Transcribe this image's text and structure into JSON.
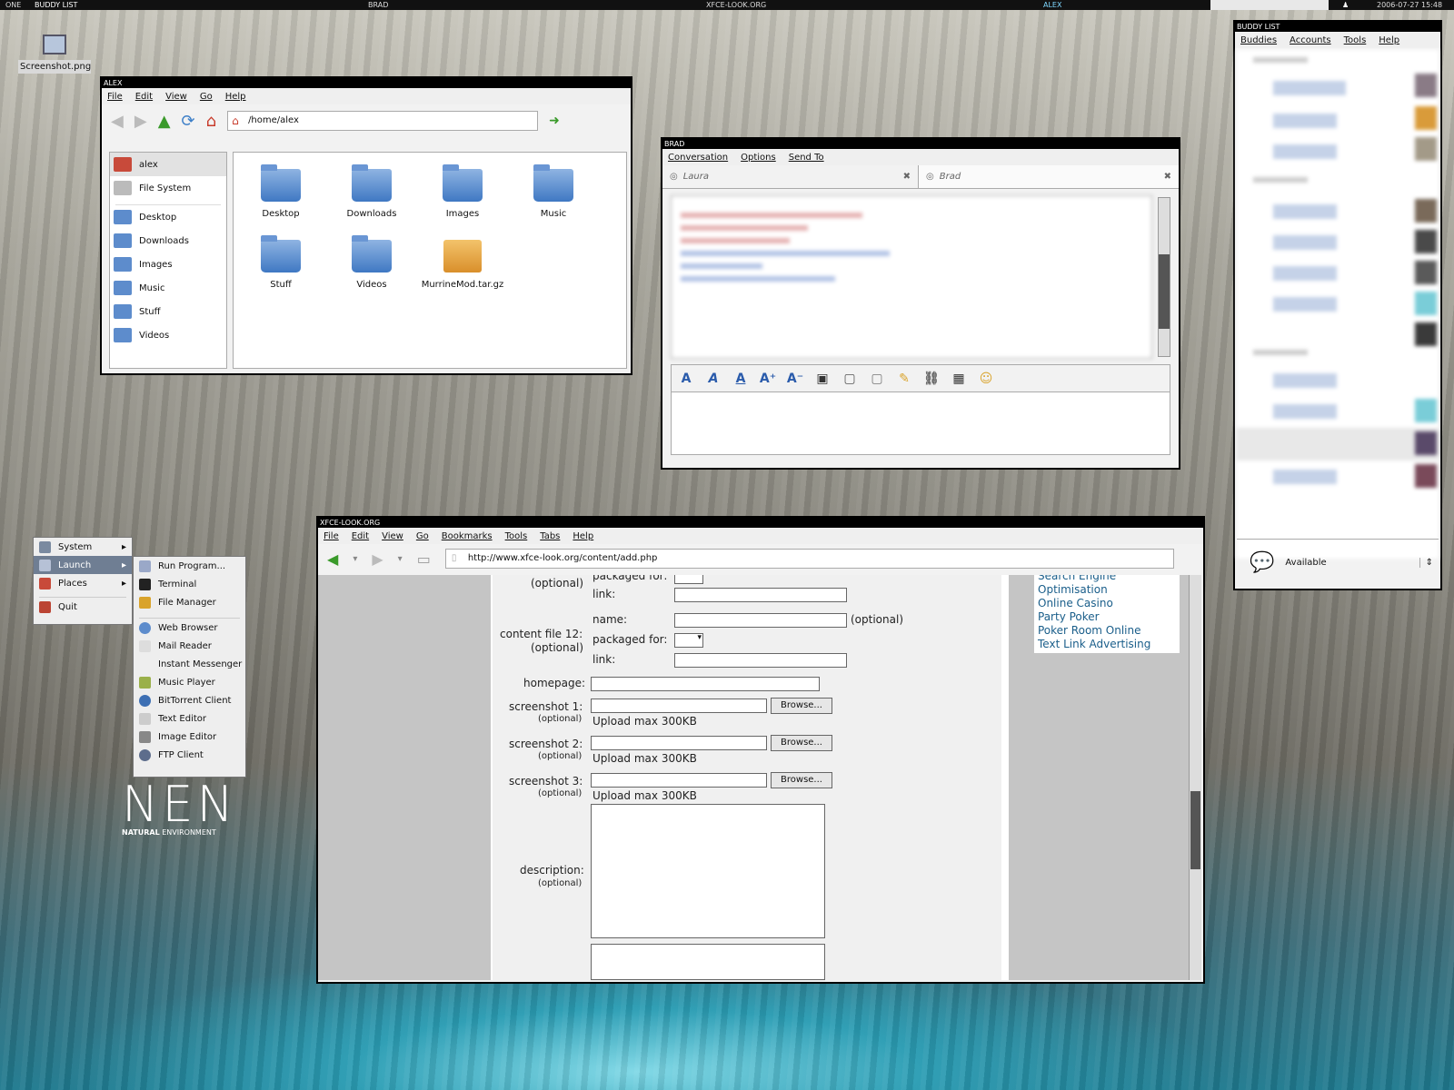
{
  "panel": {
    "left": "ONE",
    "buddy": "BUDDY LIST",
    "brad": "BRAD",
    "xfce": "XFCE-LOOK.ORG",
    "alex": "ALEX",
    "clock": "2006-07-27 15:48"
  },
  "desktop": {
    "screenshot_icon": "Screenshot.png",
    "logo_big": "NEN",
    "logo_small1": "NATURAL",
    "logo_small2": "ENVIRONMENT"
  },
  "fm": {
    "title": "ALEX",
    "menu": [
      "File",
      "Edit",
      "View",
      "Go",
      "Help"
    ],
    "path": "/home/alex",
    "sidebar": [
      "alex",
      "File System",
      "Desktop",
      "Downloads",
      "Images",
      "Music",
      "Stuff",
      "Videos"
    ],
    "files": [
      "Desktop",
      "Downloads",
      "Images",
      "Music",
      "Stuff",
      "Videos",
      "MurrineMod.tar.gz"
    ]
  },
  "chat": {
    "title": "BRAD",
    "menu": [
      "Conversation",
      "Options",
      "Send To"
    ],
    "tabs": [
      "Laura",
      "Brad"
    ]
  },
  "buddy": {
    "title": "BUDDY LIST",
    "menu": [
      "Buddies",
      "Accounts",
      "Tools",
      "Help"
    ],
    "status": "Available"
  },
  "launch": {
    "main": [
      "System",
      "Launch",
      "Places",
      "Quit"
    ],
    "sub": [
      "Run Program...",
      "Terminal",
      "File Manager",
      "Web Browser",
      "Mail Reader",
      "Instant Messenger",
      "Music Player",
      "BitTorrent Client",
      "Text Editor",
      "Image Editor",
      "FTP Client"
    ]
  },
  "browser": {
    "title": "XFCE-LOOK.ORG",
    "menu": [
      "File",
      "Edit",
      "View",
      "Go",
      "Bookmarks",
      "Tools",
      "Tabs",
      "Help"
    ],
    "url": "http://www.xfce-look.org/content/add.php",
    "form": {
      "optional": "(optional)",
      "packaged": "packaged for:",
      "link": "link:",
      "cf12": "content file 12:",
      "name": "name:",
      "homepage": "homepage:",
      "ss1": "screenshot 1:",
      "ss2": "screenshot 2:",
      "ss3": "screenshot 3:",
      "browse": "Browse...",
      "upload": "Upload max 300KB",
      "description": "description:"
    },
    "ads": [
      "Search Engine",
      "Optimisation",
      "Online Casino",
      "Party Poker",
      "Poker Room Online",
      "Text Link Advertising"
    ]
  }
}
